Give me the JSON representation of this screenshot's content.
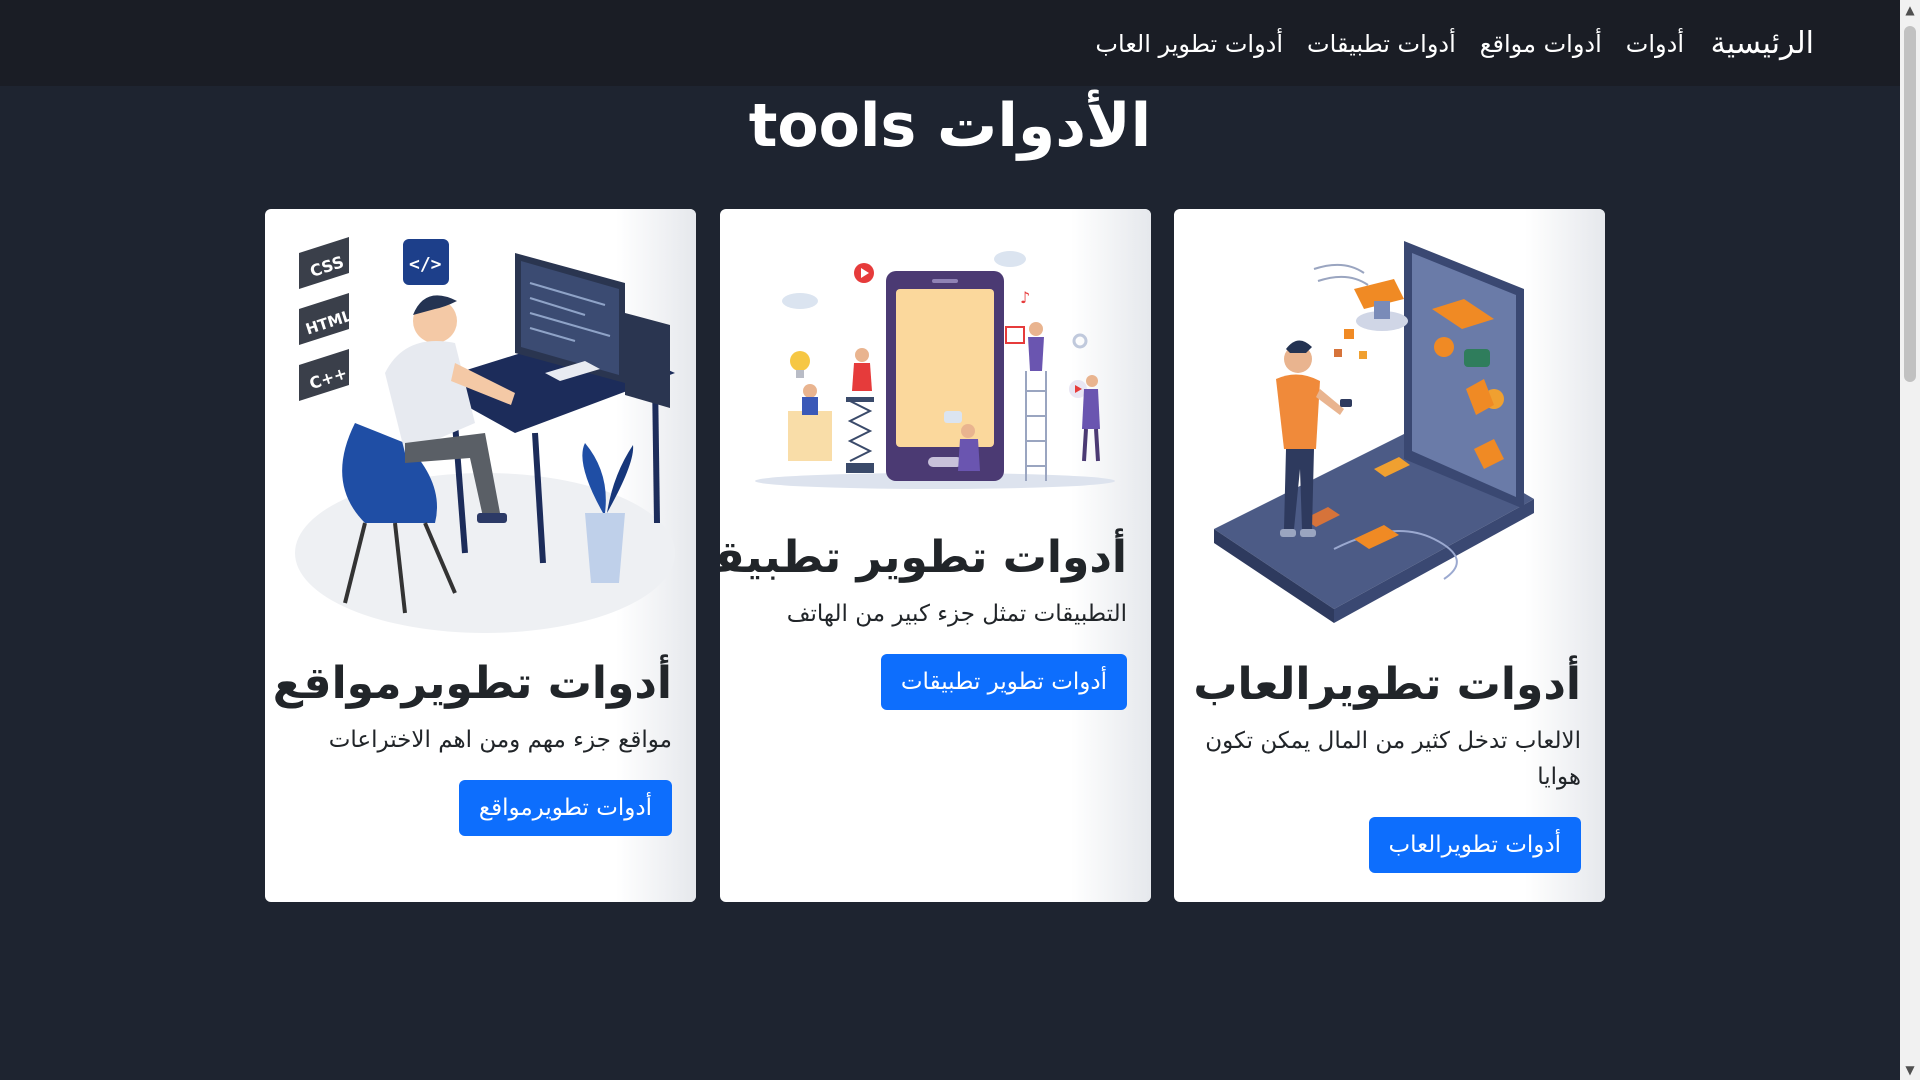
{
  "nav": {
    "brand": "الرئيسية",
    "links": [
      "أدوات",
      "أدوات مواقع",
      "أدوات تطبيقات",
      "أدوات تطوير العاب"
    ]
  },
  "page_title": "tools الأدوات",
  "cards": [
    {
      "title": "أدوات تطويرمواقع",
      "text": "مواقع جزء مهم ومن اهم الاختراعات",
      "button": "أدوات تطويرمواقع",
      "image_icon": "web-developer-illustration"
    },
    {
      "title": "أدوات تطوير تطبيقات",
      "text": "التطبيقات تمثل جزء كبير من الهاتف",
      "button": "أدوات تطوير تطبيقات",
      "image_icon": "app-development-illustration"
    },
    {
      "title": "أدوات تطويرالعاب",
      "text": "الالعاب تدخل كثير من المال يمكن تكون هوايا",
      "button": "أدوات تطويرالعاب",
      "image_icon": "game-development-illustration"
    }
  ],
  "code_badges": [
    "CSS",
    "HTML",
    "C++"
  ],
  "colors": {
    "page_background": "#1e2430",
    "navbar_background": "#1a1d25",
    "button": "#0d6efd",
    "card_background": "#ffffff"
  }
}
